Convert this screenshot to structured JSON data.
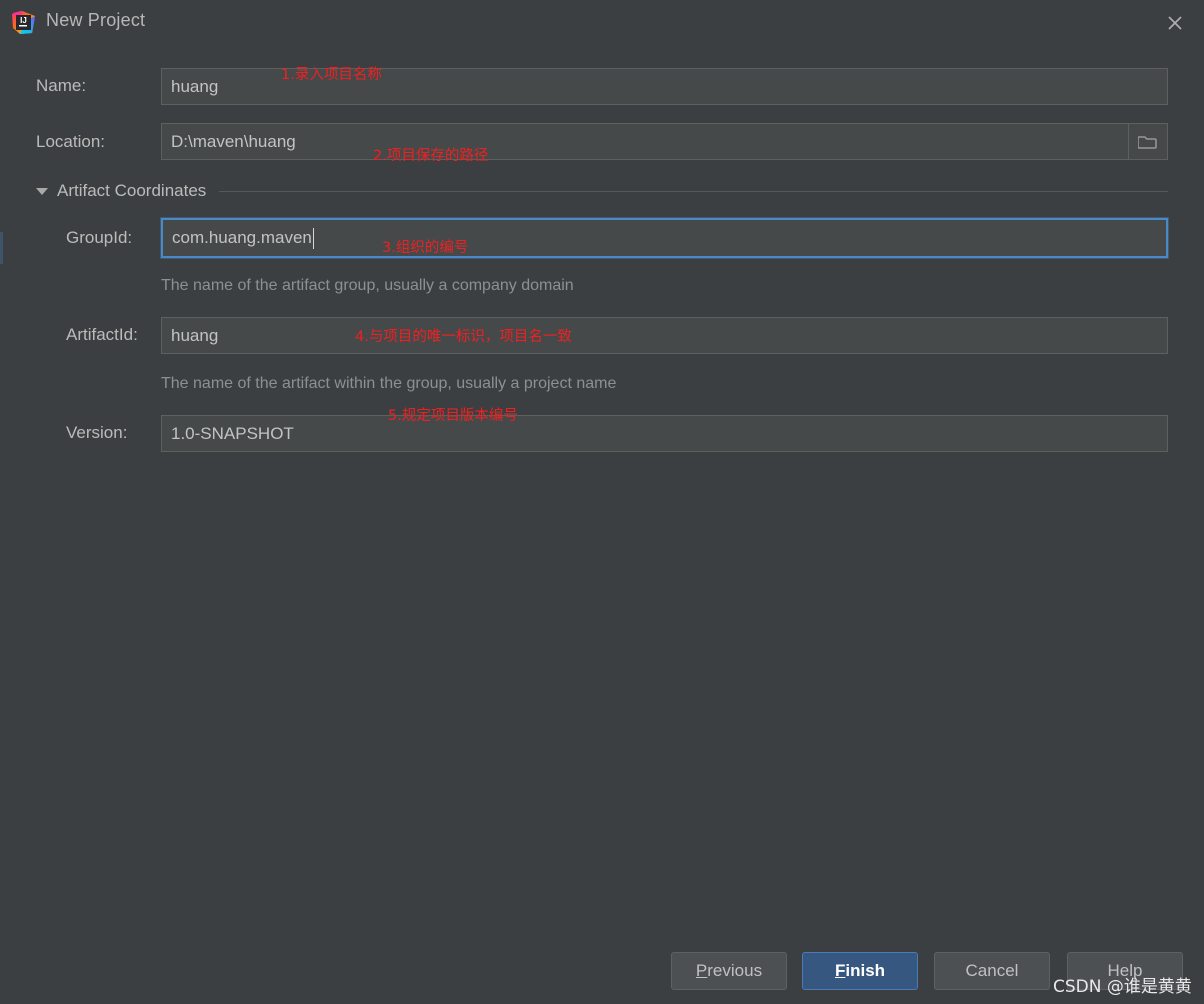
{
  "window": {
    "title": "New Project",
    "logo_icon": "intellij-idea-logo",
    "close_icon": "close-icon"
  },
  "form": {
    "name": {
      "label": "Name:",
      "value": "huang",
      "placeholder": ""
    },
    "location": {
      "label": "Location:",
      "value": "D:\\maven\\huang",
      "placeholder": "",
      "browse_icon": "folder-icon"
    },
    "section": {
      "title": "Artifact Coordinates",
      "expanded": true,
      "triangle_icon": "triangle-down-icon"
    },
    "group_id": {
      "label": "GroupId:",
      "value": "com.huang.maven",
      "focused": true,
      "hint": "The name of the artifact group, usually a company domain"
    },
    "artifact_id": {
      "label": "ArtifactId:",
      "value": "huang",
      "focused": false,
      "hint": "The name of the artifact within the group, usually a project name"
    },
    "version": {
      "label": "Version:",
      "value": "1.0-SNAPSHOT",
      "focused": false
    }
  },
  "annotations": [
    {
      "text": "1.录入项目名称"
    },
    {
      "text": "2.项目保存的路径"
    },
    {
      "text": "3.组织的编号"
    },
    {
      "text": "4.与项目的唯一标识，项目名一致"
    },
    {
      "text": "5.规定项目版本编号"
    }
  ],
  "buttons": {
    "previous": {
      "label_pre": "",
      "mnemonic": "P",
      "label_post": "revious"
    },
    "finish": {
      "label_pre": "",
      "mnemonic": "F",
      "label_post": "inish"
    },
    "cancel": {
      "label": "Cancel"
    },
    "help": {
      "label": "Help"
    }
  },
  "watermark": {
    "text": "CSDN @谁是黄黄"
  },
  "colors": {
    "dialog_background": "#3c3f41",
    "field_background": "#45494a",
    "field_border": "#5e6060",
    "focus_border": "#4a88c7",
    "primary_button": "#365880",
    "annotation_red": "#f02020",
    "text": "#bbbbbb",
    "hint_text": "#8d9091"
  }
}
